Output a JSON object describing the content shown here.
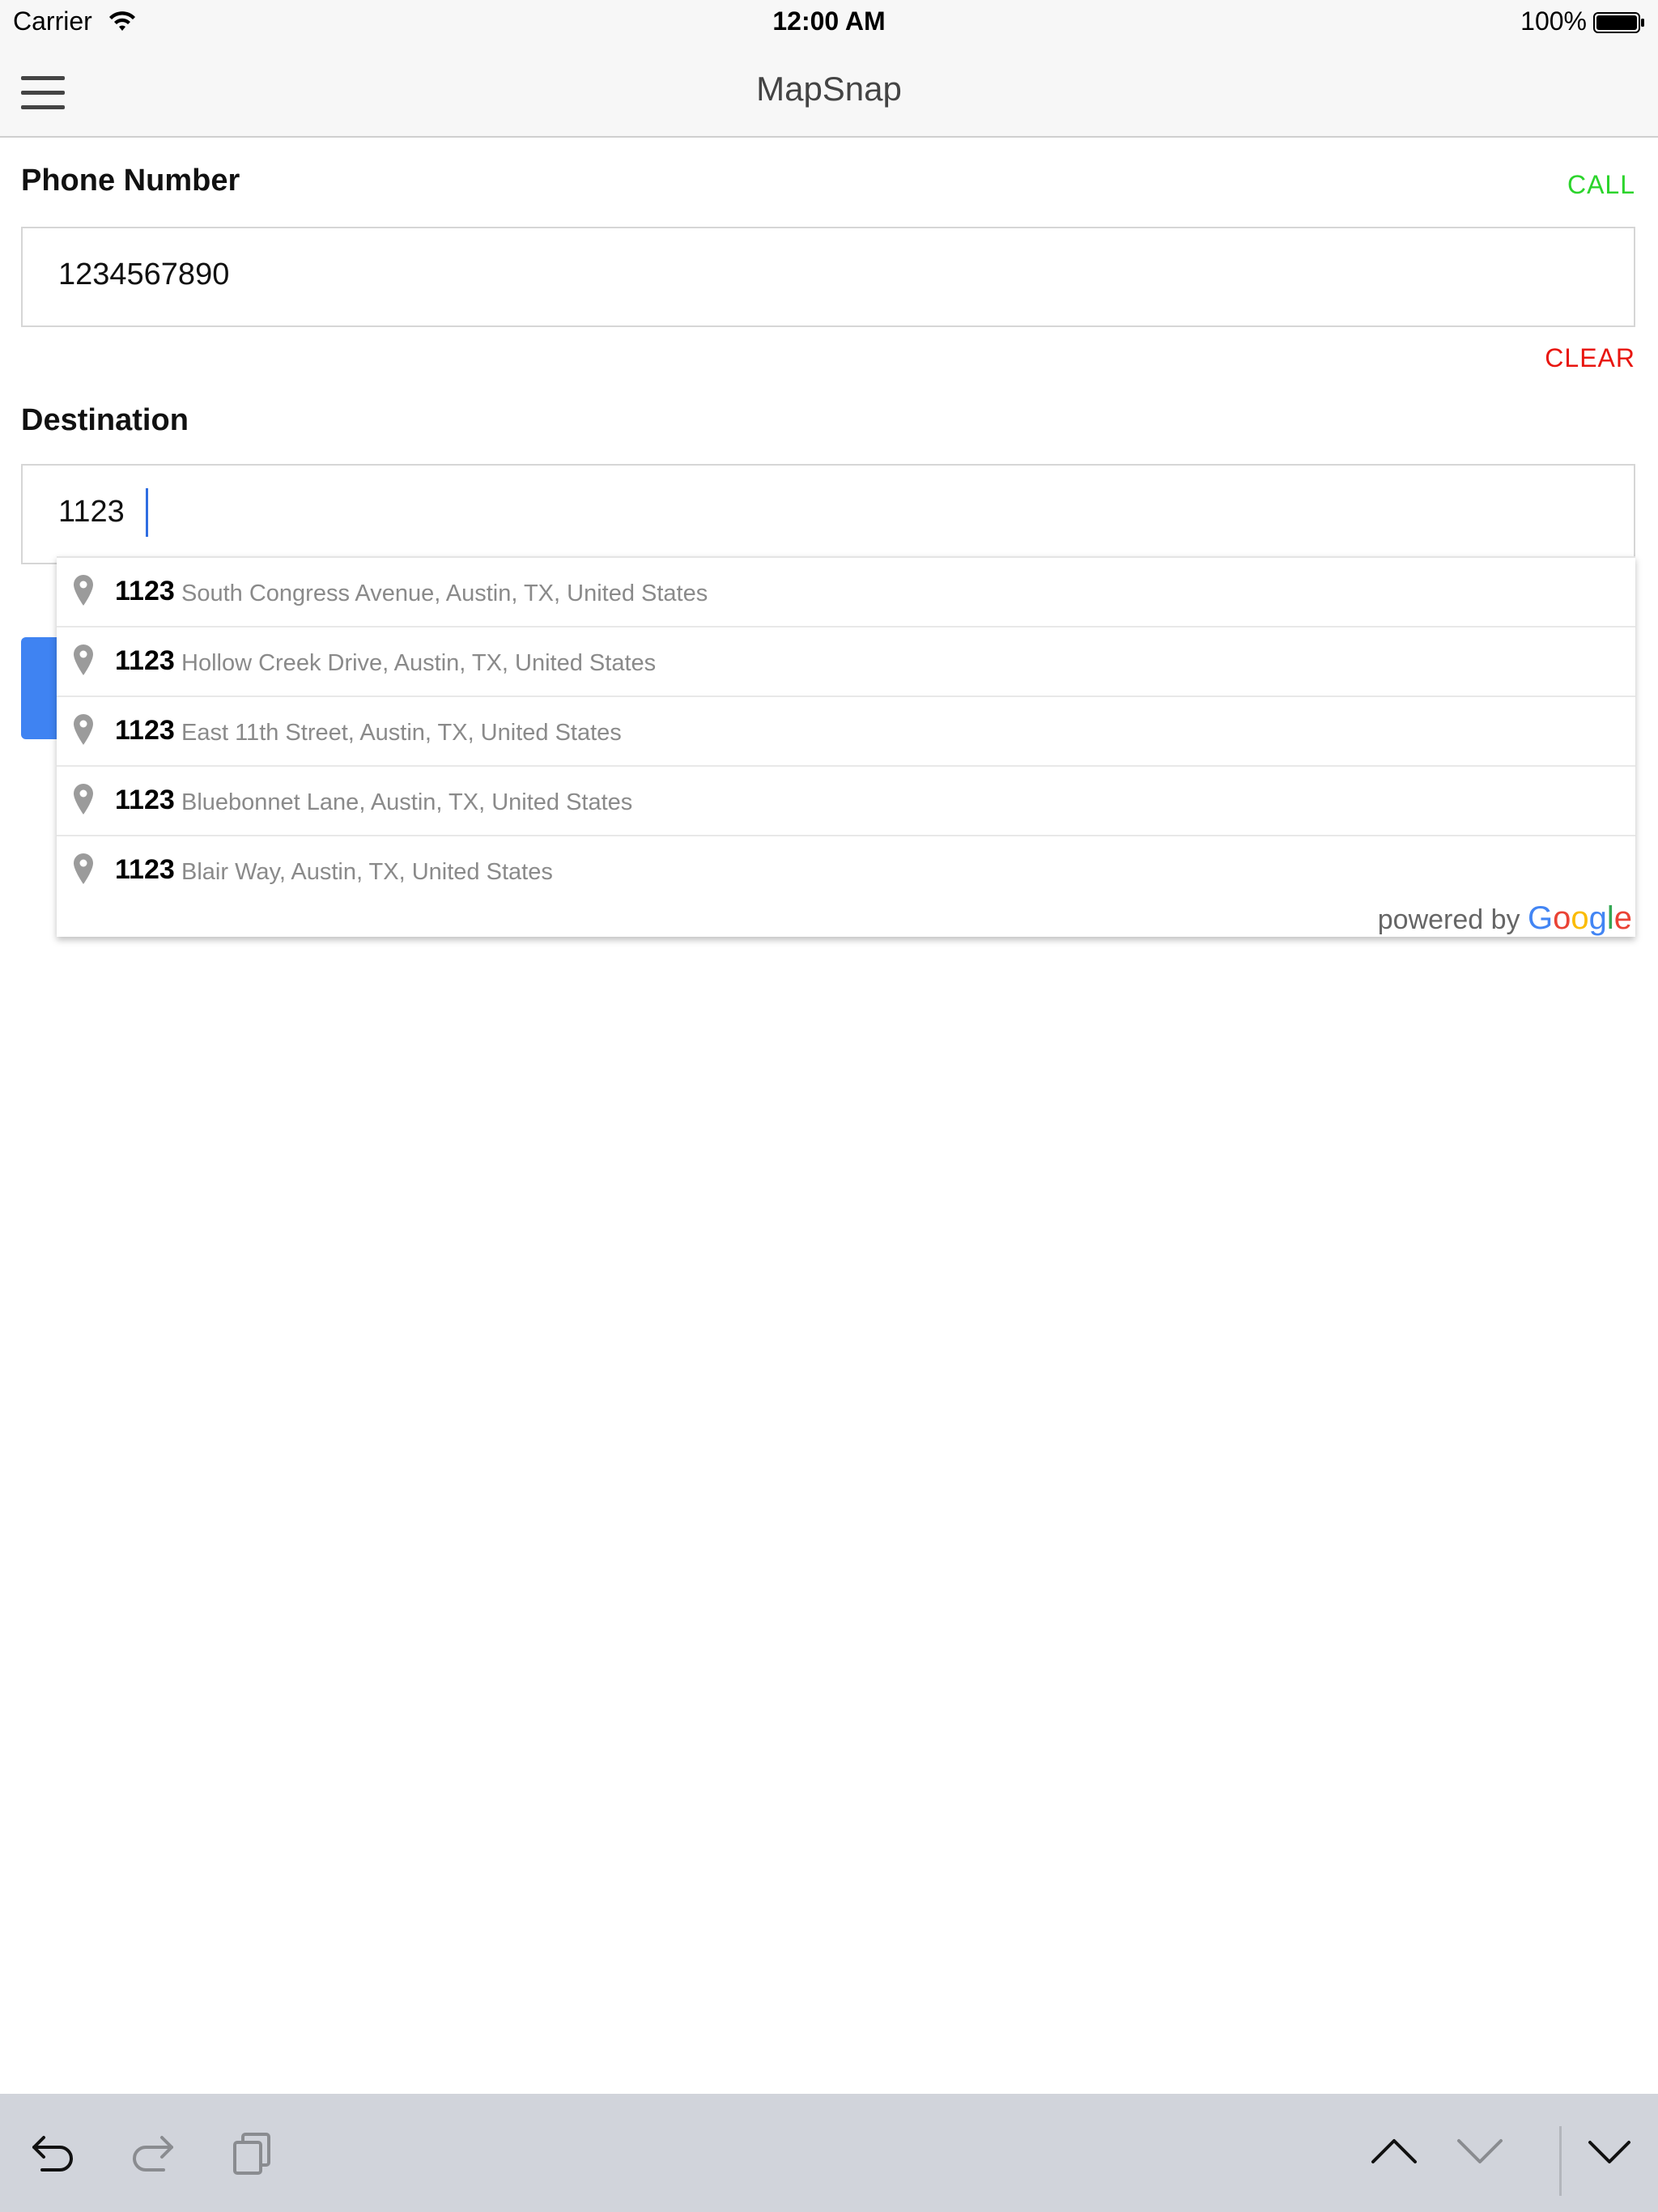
{
  "status_bar": {
    "carrier": "Carrier",
    "time": "12:00 AM",
    "battery": "100%"
  },
  "nav": {
    "title": "MapSnap",
    "menu_icon": "hamburger-menu-icon"
  },
  "form": {
    "phone": {
      "label": "Phone Number",
      "value": "1234567890",
      "call_label": "CALL",
      "clear_label": "CLEAR"
    },
    "destination": {
      "label": "Destination",
      "value": "1123"
    }
  },
  "autocomplete": {
    "suggestions": [
      {
        "main": "1123",
        "secondary": "South Congress Avenue, Austin, TX, United States"
      },
      {
        "main": "1123",
        "secondary": "Hollow Creek Drive, Austin, TX, United States"
      },
      {
        "main": "1123",
        "secondary": "East 11th Street, Austin, TX, United States"
      },
      {
        "main": "1123",
        "secondary": "Bluebonnet Lane, Austin, TX, United States"
      },
      {
        "main": "1123",
        "secondary": "Blair Way, Austin, TX, United States"
      }
    ],
    "powered_by": "powered by",
    "provider": "Google"
  },
  "colors": {
    "call": "#2cd42c",
    "clear": "#e8150f",
    "accent_blue": "#3f83f2",
    "toolbar_bg": "#d1d4db"
  },
  "toolbar": {
    "icons": [
      "undo-icon",
      "redo-icon",
      "clipboard-icon",
      "previous-field-icon",
      "next-field-icon",
      "dismiss-keyboard-icon"
    ]
  }
}
